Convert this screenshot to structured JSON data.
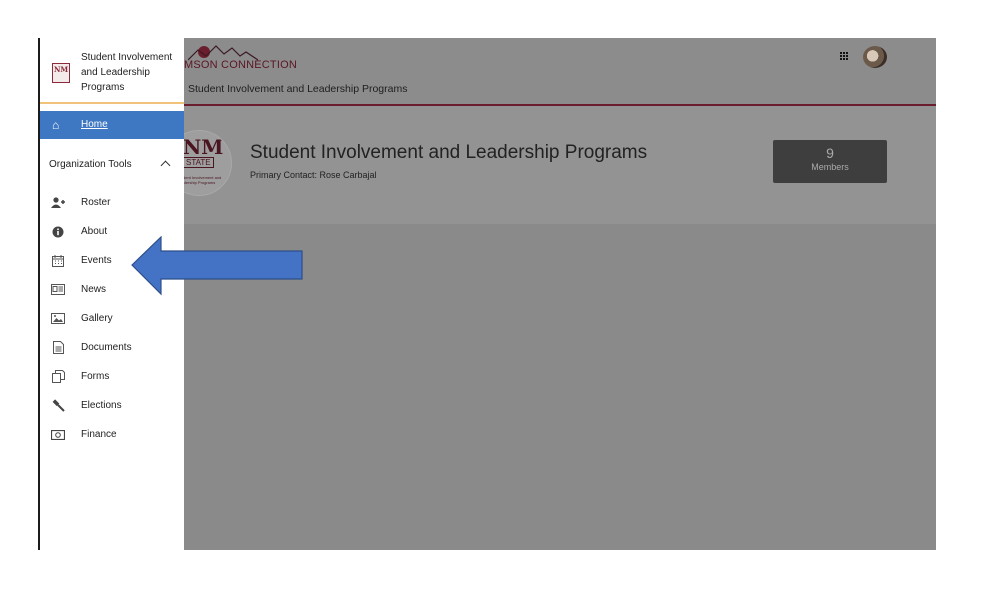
{
  "app": {
    "brand": "MSON CONNECTION",
    "breadcrumb": "Student Involvement and Leadership Programs"
  },
  "org": {
    "title": "Student Involvement and Leadership Programs",
    "primary_contact": "Primary Contact: Rose Carbajal",
    "logo_text": {
      "top": "NM",
      "middle": "STATE",
      "bottom": "Student Involvement and Leadership Programs"
    },
    "members_count": "9",
    "members_label": "Members"
  },
  "sidebar": {
    "org_name": "Student Involvement and Leadership Programs",
    "logo_text": "NM",
    "home_label": "Home",
    "section_label": "Organization Tools",
    "items": [
      {
        "label": "Roster",
        "icon": "add-user-icon"
      },
      {
        "label": "About",
        "icon": "info-icon"
      },
      {
        "label": "Events",
        "icon": "calendar-icon"
      },
      {
        "label": "News",
        "icon": "newspaper-icon"
      },
      {
        "label": "Gallery",
        "icon": "image-icon"
      },
      {
        "label": "Documents",
        "icon": "document-icon"
      },
      {
        "label": "Forms",
        "icon": "forms-icon"
      },
      {
        "label": "Elections",
        "icon": "gavel-icon"
      },
      {
        "label": "Finance",
        "icon": "money-icon"
      }
    ]
  },
  "colors": {
    "accent_blue": "#3f78c2",
    "brand_maroon": "#6b1f2e",
    "arrow_fill": "#4472c4"
  }
}
